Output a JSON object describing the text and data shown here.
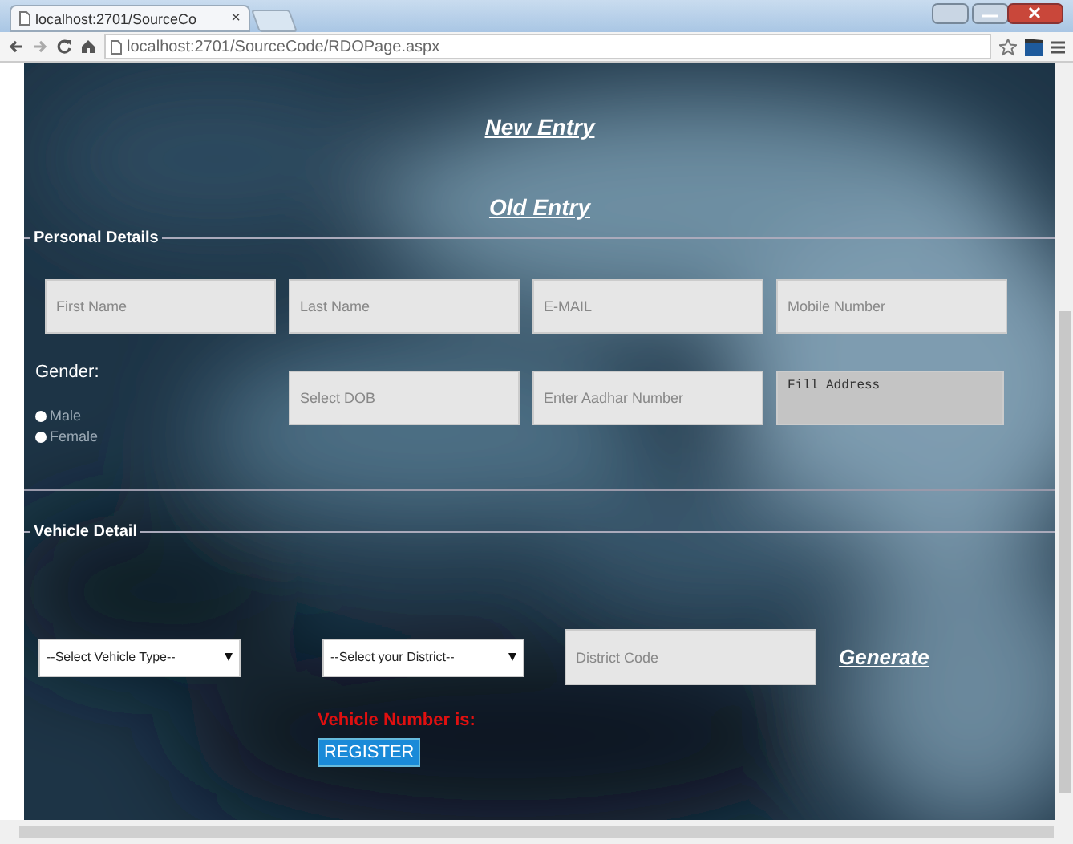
{
  "browser": {
    "tab": {
      "title": "localhost:2701/SourceCo",
      "close": "×"
    },
    "address": "localhost:2701/SourceCode/RDOPage.aspx"
  },
  "links": [
    {
      "label": "New Entry"
    },
    {
      "label": "Old Entry"
    }
  ],
  "personal": {
    "legend": "Personal Details",
    "fields": [
      {
        "kind": "input",
        "placeholder": "First Name"
      },
      {
        "kind": "input",
        "placeholder": "Last Name"
      },
      {
        "kind": "input",
        "placeholder": "E-MAIL"
      },
      {
        "kind": "input",
        "placeholder": "Mobile Number"
      }
    ],
    "gender": {
      "label": "Gender:",
      "options": [
        {
          "label": "Male",
          "selected": false
        },
        {
          "label": "Female",
          "selected": false
        }
      ]
    },
    "fields_row2": [
      {
        "kind": "input",
        "placeholder": "Select DOB"
      },
      {
        "kind": "input",
        "placeholder": "Enter Aadhar Number"
      },
      {
        "kind": "textarea",
        "placeholder": "Fill Address"
      }
    ]
  },
  "vehicle": {
    "legend": "Vehicle Detail",
    "selects": [
      {
        "value": "--Select Vehicle Type--"
      },
      {
        "value": "--Select your District--"
      }
    ],
    "district_code": {
      "placeholder": "District Code"
    },
    "generate": "Generate",
    "result_label": "Vehicle Number is:",
    "register": "REGISTER"
  }
}
